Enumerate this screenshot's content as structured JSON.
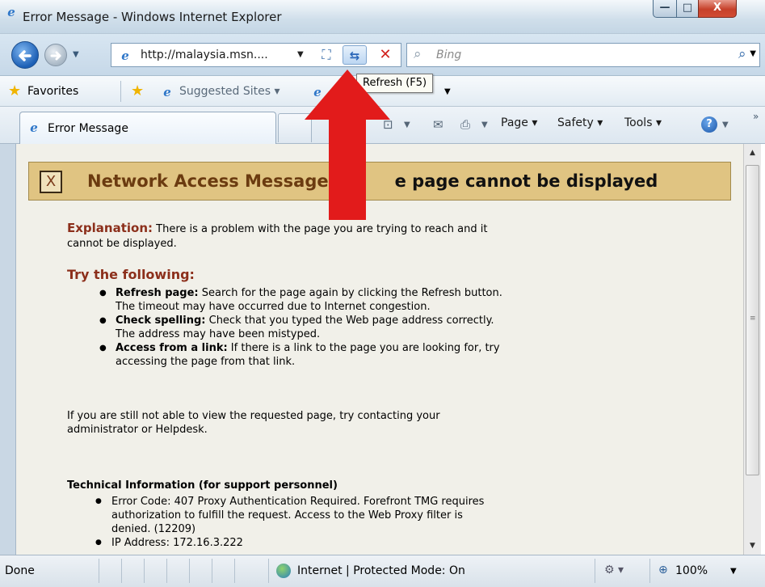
{
  "window": {
    "title": "Error Message - Windows Internet Explorer",
    "minimize_glyph": "—",
    "maximize_glyph": "□",
    "close_glyph": "X"
  },
  "navigation": {
    "address_url": "http://malaysia.msn....",
    "search_placeholder": "Bing",
    "refresh_tooltip": "Refresh (F5)"
  },
  "favorites_bar": {
    "favorites_label": "Favorites",
    "suggested_sites_label": "Suggested Sites ▾"
  },
  "tabs": [
    {
      "label": "Error Message"
    }
  ],
  "command_bar": {
    "page_label": "Page ▾",
    "safety_label": "Safety ▾",
    "tools_label": "Tools ▾",
    "help_glyph": "?"
  },
  "page": {
    "banner_prefix": "Network Access Message",
    "banner_suffix": "e page cannot be displayed",
    "explanation_label": "Explanation:",
    "explanation_text": " There is a problem with the page you are trying to reach and it cannot be displayed.",
    "try_heading": "Try the following:",
    "suggestions": [
      {
        "title": "Refresh page:",
        "text": " Search for the page again by clicking the Refresh button. The timeout may have occurred due to Internet congestion."
      },
      {
        "title": "Check spelling:",
        "text": " Check that you typed the Web page address correctly. The address may have been mistyped."
      },
      {
        "title": "Access from a link:",
        "text": " If there is a link to the page you are looking for, try accessing the page from that link."
      }
    ],
    "still_text": "If you are still not able to view the requested page, try contacting your administrator or Helpdesk.",
    "tech_heading": "Technical Information (for support personnel)",
    "tech_items": [
      "Error Code: 407 Proxy Authentication Required. Forefront TMG requires authorization to fulfill the request. Access to the Web Proxy filter is denied. (12209)",
      "IP Address: 172.16.3.222"
    ]
  },
  "status_bar": {
    "status_text": "Done",
    "zone_text": "Internet | Protected Mode: On",
    "zoom_text": "100%"
  },
  "colors": {
    "banner_bg": "#e0c482",
    "accent_red_brown": "#8c2f1b",
    "arrow_red": "#e21b1b",
    "content_bg": "#f1f0e9"
  },
  "icons": {
    "back": "back-arrow-icon",
    "forward": "forward-arrow-icon",
    "compat": "compatibility-view-icon",
    "refresh": "refresh-icon",
    "stop": "stop-icon",
    "search": "search-icon",
    "favorites": "favorites-star-icon",
    "rss": "rss-feed-icon",
    "mail": "mail-icon",
    "print": "print-icon",
    "help": "help-icon"
  }
}
